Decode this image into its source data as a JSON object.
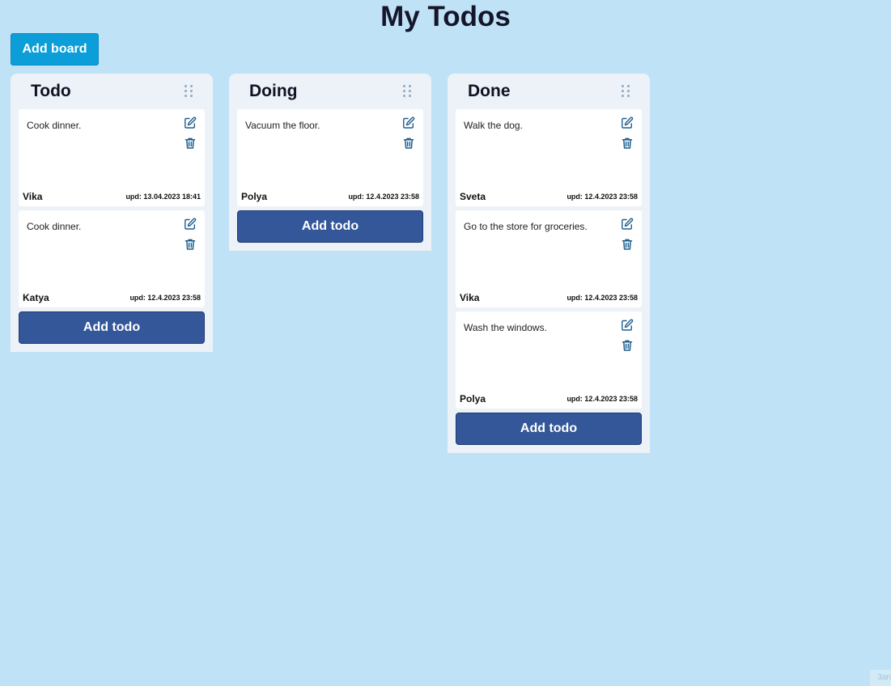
{
  "header": {
    "title": "My Todos",
    "add_board_label": "Add board"
  },
  "colors": {
    "background": "#bfe2f7",
    "board_background": "#ecf2f8",
    "add_board_button": "#0c9ed8",
    "add_todo_button": "#34579a",
    "icon": "#1d5f8f"
  },
  "boards": [
    {
      "title": "Todo",
      "add_todo_label": "Add todo",
      "cards": [
        {
          "text": "Cook dinner.",
          "author": "Vika",
          "updated": "upd: 13.04.2023 18:41"
        },
        {
          "text": "Cook dinner.",
          "author": "Katya",
          "updated": "upd: 12.4.2023 23:58"
        }
      ]
    },
    {
      "title": "Doing",
      "add_todo_label": "Add todo",
      "cards": [
        {
          "text": "Vacuum the floor.",
          "author": "Polya",
          "updated": "upd: 12.4.2023 23:58"
        }
      ]
    },
    {
      "title": "Done",
      "add_todo_label": "Add todo",
      "cards": [
        {
          "text": "Walk the dog.",
          "author": "Sveta",
          "updated": "upd: 12.4.2023 23:58"
        },
        {
          "text": "Go to the store for groceries.",
          "author": "Vika",
          "updated": "upd: 12.4.2023 23:58"
        },
        {
          "text": "Wash the windows.",
          "author": "Polya",
          "updated": "upd: 12.4.2023 23:58"
        }
      ]
    }
  ],
  "icons": {
    "edit": "edit-icon",
    "delete": "trash-icon",
    "drag": "drag-handle-icon"
  },
  "corner": {
    "text": "3an"
  }
}
